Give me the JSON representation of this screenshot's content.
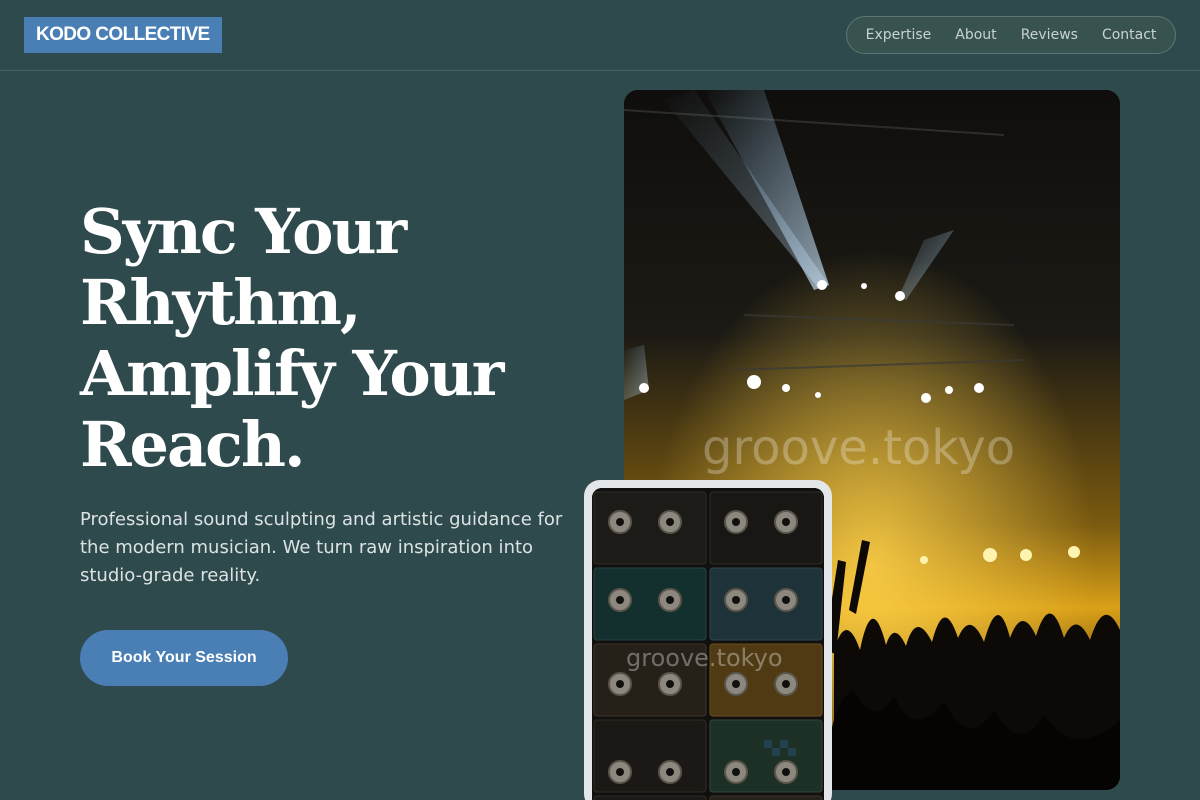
{
  "brand": {
    "name": "KODO COLLECTIVE",
    "color": "#4a7fb5"
  },
  "nav": {
    "items": [
      {
        "label": "Expertise"
      },
      {
        "label": "About"
      },
      {
        "label": "Reviews"
      },
      {
        "label": "Contact"
      }
    ]
  },
  "hero": {
    "title_lines": [
      "Sync Your",
      "Rhythm,",
      "Amplify Your",
      "Reach."
    ],
    "subtitle": "Professional sound sculpting and artistic guidance for the modern musician. We turn raw inspiration into studio-grade reality.",
    "cta_label": "Book Your Session"
  },
  "images": {
    "main": {
      "watermark": "groove.tokyo"
    },
    "phone": {
      "watermark": "groove.tokyo"
    }
  },
  "colors": {
    "background": "#2f4a4d",
    "accent": "#4a7fb5",
    "text": "#ffffff"
  }
}
